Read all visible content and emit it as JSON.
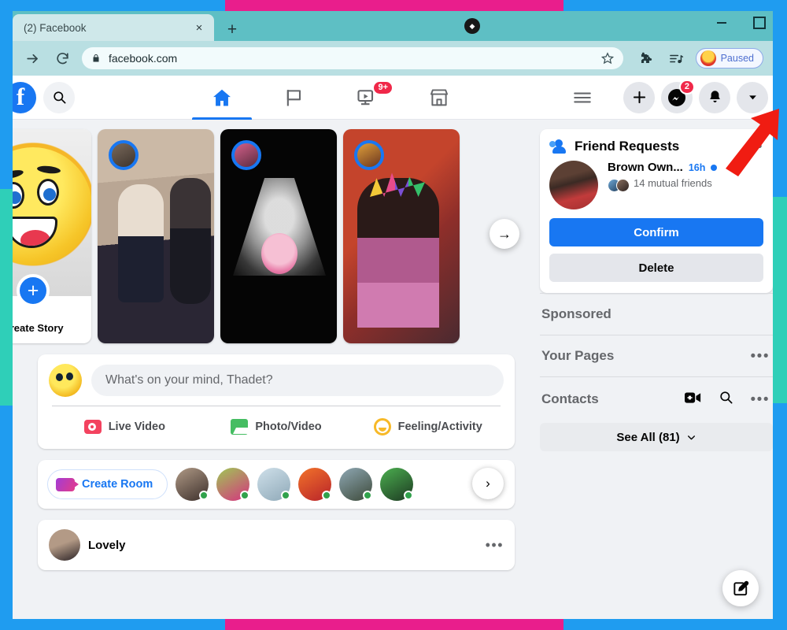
{
  "browser": {
    "tab": {
      "title": "(2) Facebook",
      "close_label": "×"
    },
    "new_tab_label": "+",
    "address": "facebook.com",
    "extension_pill": {
      "label": "Paused"
    },
    "window": {
      "minimize": "–",
      "maximize": "□"
    }
  },
  "fb_nav": {
    "logo": "f",
    "tabs": [
      {
        "name": "home",
        "active": true,
        "badge": ""
      },
      {
        "name": "pages",
        "active": false,
        "badge": ""
      },
      {
        "name": "watch",
        "active": false,
        "badge": "9+"
      },
      {
        "name": "marketplace",
        "active": false,
        "badge": ""
      }
    ],
    "menu_label": "menu",
    "actions": [
      {
        "name": "create",
        "badge": ""
      },
      {
        "name": "messenger",
        "badge": "2"
      },
      {
        "name": "notifications",
        "badge": ""
      },
      {
        "name": "account",
        "badge": ""
      }
    ]
  },
  "stories": {
    "create_story_label": "Create Story",
    "next_label": "→",
    "items": [
      {
        "name": "create-story"
      },
      {
        "name": "story-2"
      },
      {
        "name": "story-3"
      },
      {
        "name": "story-4"
      }
    ]
  },
  "composer": {
    "placeholder": "What's on your mind, Thadet?",
    "actions": [
      {
        "label": "Live Video"
      },
      {
        "label": "Photo/Video"
      },
      {
        "label": "Feeling/Activity"
      }
    ]
  },
  "rooms": {
    "create_room_label": "Create Room",
    "next_label": "›",
    "contacts": 6
  },
  "post": {
    "author": "Lovely",
    "more_label": "•••"
  },
  "friend_requests": {
    "title": "Friend Requests",
    "more_label": "•••",
    "request": {
      "name": "Brown Own...",
      "time": "16h",
      "mutual": "14 mutual friends",
      "confirm_label": "Confirm",
      "delete_label": "Delete"
    }
  },
  "sidebar_sections": [
    {
      "title": "Sponsored",
      "has_more": false,
      "has_video": false,
      "has_search": false
    },
    {
      "title": "Your Pages",
      "has_more": true,
      "has_video": false,
      "has_search": false
    },
    {
      "title": "Contacts",
      "has_more": true,
      "has_video": true,
      "has_search": true
    }
  ],
  "see_all": {
    "label": "See All (81)",
    "chevron": "⌄"
  },
  "colors": {
    "fb_blue": "#1877f2",
    "badge_red": "#f02849",
    "frame_blue": "#1f9cf0",
    "frame_pink": "#e91e8c",
    "frame_teal": "#2fcfb8",
    "online_green": "#31a24c"
  }
}
